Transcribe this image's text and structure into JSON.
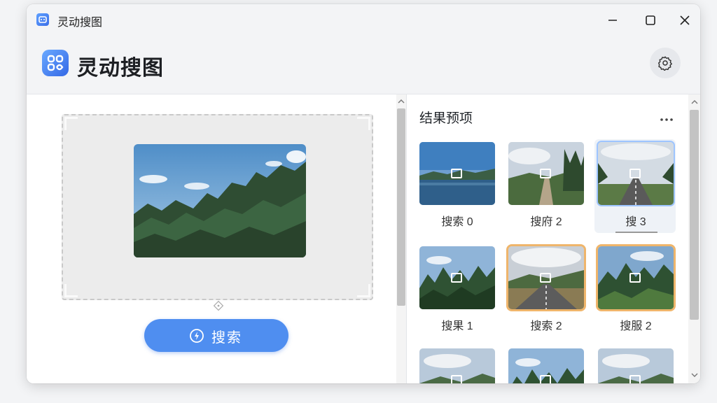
{
  "window": {
    "title": "灵动搜图"
  },
  "header": {
    "app_name": "灵动搜图"
  },
  "search": {
    "button_label": "搜索"
  },
  "results": {
    "title": "结果预项",
    "items": [
      {
        "caption": "搜索 0",
        "scene": "lake",
        "selected": "none"
      },
      {
        "caption": "搜府 2",
        "scene": "road",
        "selected": "none"
      },
      {
        "caption": "搜 3",
        "scene": "road2",
        "selected": "blue"
      },
      {
        "caption": "搜果 1",
        "scene": "forest",
        "selected": "none"
      },
      {
        "caption": "搜索 2",
        "scene": "road3",
        "selected": "orange"
      },
      {
        "caption": "搜服 2",
        "scene": "forest2",
        "selected": "orange"
      },
      {
        "caption": "",
        "scene": "hills",
        "selected": "none"
      },
      {
        "caption": "",
        "scene": "forest",
        "selected": "none"
      },
      {
        "caption": "",
        "scene": "hills",
        "selected": "none"
      }
    ]
  },
  "colors": {
    "accent": "#4f8ef0",
    "selected_blue": "#9ec5ff",
    "selected_orange": "#efb56b"
  }
}
